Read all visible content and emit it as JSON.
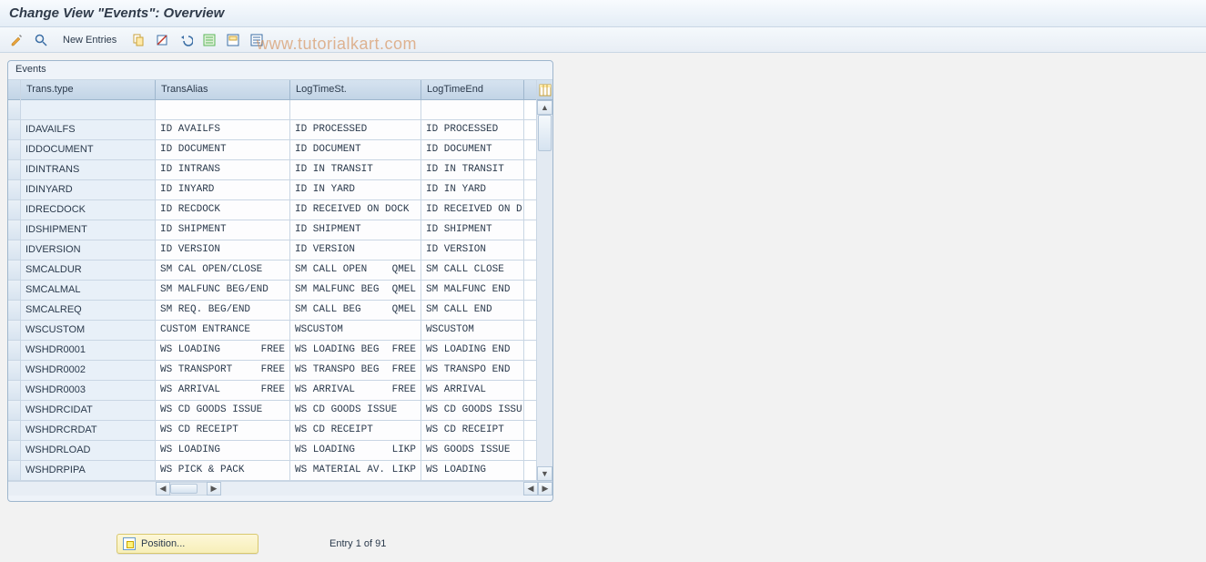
{
  "title": "Change View \"Events\": Overview",
  "watermark": "www.tutorialkart.com",
  "toolbar": {
    "new_entries_label": "New Entries"
  },
  "panel": {
    "title": "Events",
    "columns": [
      "Trans.type",
      "TransAlias",
      "LogTimeSt.",
      "LogTimeEnd"
    ],
    "rows": [
      {
        "trans": "",
        "alias": "",
        "st": "",
        "end": ""
      },
      {
        "trans": "IDAVAILFS",
        "alias": "ID AVAILFS",
        "st": "ID PROCESSED",
        "end": "ID PROCESSED"
      },
      {
        "trans": "IDDOCUMENT",
        "alias": "ID DOCUMENT",
        "st": "ID DOCUMENT",
        "end": "ID DOCUMENT"
      },
      {
        "trans": "IDINTRANS",
        "alias": "ID INTRANS",
        "st": "ID IN TRANSIT",
        "end": "ID IN TRANSIT"
      },
      {
        "trans": "IDINYARD",
        "alias": "ID INYARD",
        "st": "ID IN YARD",
        "end": "ID IN YARD"
      },
      {
        "trans": "IDRECDOCK",
        "alias": "ID RECDOCK",
        "st": "ID RECEIVED ON DOCK",
        "end": "ID RECEIVED ON D"
      },
      {
        "trans": "IDSHIPMENT",
        "alias": "ID SHIPMENT",
        "st": "ID SHIPMENT",
        "end": "ID SHIPMENT"
      },
      {
        "trans": "IDVERSION",
        "alias": "ID VERSION",
        "st": "ID VERSION",
        "end": "ID VERSION"
      },
      {
        "trans": "SMCALDUR",
        "alias": "SM CAL OPEN/CLOSE",
        "st": "SM CALL OPEN",
        "st2": "QMEL",
        "end": "SM CALL CLOSE"
      },
      {
        "trans": "SMCALMAL",
        "alias": "SM MALFUNC BEG/END",
        "st": "SM MALFUNC BEG",
        "st2": "QMEL",
        "end": "SM MALFUNC END"
      },
      {
        "trans": "SMCALREQ",
        "alias": "SM REQ. BEG/END",
        "st": "SM CALL BEG",
        "st2": "QMEL",
        "end": "SM CALL END"
      },
      {
        "trans": "WSCUSTOM",
        "alias": "CUSTOM ENTRANCE",
        "st": "WSCUSTOM",
        "end": "WSCUSTOM"
      },
      {
        "trans": "WSHDR0001",
        "alias": "WS LOADING",
        "alias2": "FREE",
        "st": "WS LOADING BEG",
        "st2": "FREE",
        "end": "WS LOADING END"
      },
      {
        "trans": "WSHDR0002",
        "alias": "WS TRANSPORT",
        "alias2": "FREE",
        "st": "WS TRANSPO BEG",
        "st2": "FREE",
        "end": "WS TRANSPO END"
      },
      {
        "trans": "WSHDR0003",
        "alias": "WS ARRIVAL",
        "alias2": "FREE",
        "st": "WS ARRIVAL",
        "st2": "FREE",
        "end": "WS ARRIVAL"
      },
      {
        "trans": "WSHDRCIDAT",
        "alias": "WS CD GOODS ISSUE",
        "st": "WS CD GOODS ISSUE",
        "end": "WS CD GOODS ISSU"
      },
      {
        "trans": "WSHDRCRDAT",
        "alias": "WS CD RECEIPT",
        "st": "WS CD RECEIPT",
        "end": "WS CD RECEIPT"
      },
      {
        "trans": "WSHDRLOAD",
        "alias": "WS LOADING",
        "st": "WS LOADING",
        "st2": "LIKP",
        "end": "WS GOODS ISSUE"
      },
      {
        "trans": "WSHDRPIPA",
        "alias": "WS PICK & PACK",
        "st": "WS MATERIAL AV.",
        "st2": "LIKP",
        "end": "WS LOADING"
      }
    ]
  },
  "footer": {
    "position_label": "Position...",
    "entry_info": "Entry 1 of 91"
  },
  "colors": {
    "accent": "#5a87b7",
    "panel_bg": "#eef3f9",
    "header_grad_top": "#d6e3f0",
    "header_grad_bot": "#c2d4e6"
  }
}
